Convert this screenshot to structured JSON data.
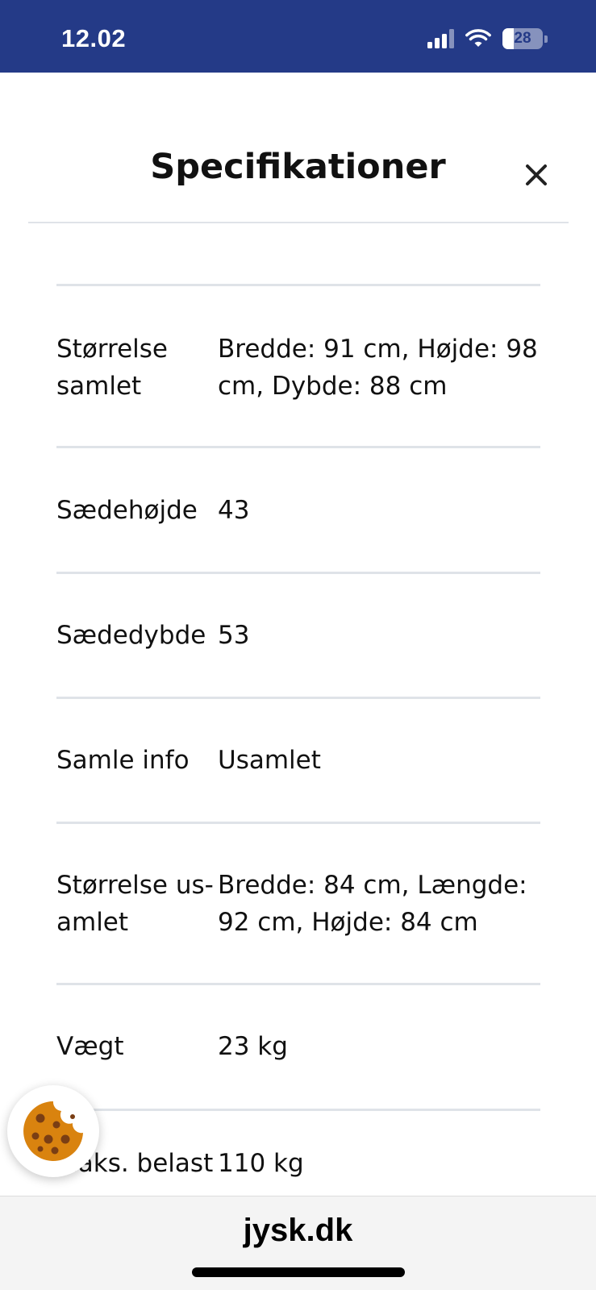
{
  "status_bar": {
    "time": "12.02",
    "battery": "28",
    "battery_level": 0.28,
    "signal_bars": 3,
    "wifi": true
  },
  "modal": {
    "title": "Specifikationer",
    "close_icon": "close-icon"
  },
  "specs": [
    {
      "label_lines": [
        "Størrelse",
        "samlet"
      ],
      "value_lines": [
        "Bredde: 91 cm, Højde: 98",
        "cm, Dybde: 88 cm"
      ]
    },
    {
      "label_lines": [
        "Sædehøjde"
      ],
      "value_lines": [
        "43"
      ]
    },
    {
      "label_lines": [
        "Sædedybde"
      ],
      "value_lines": [
        "53"
      ]
    },
    {
      "label_lines": [
        "Samle info"
      ],
      "value_lines": [
        "Usamlet"
      ]
    },
    {
      "label_lines": [
        "Størrelse us-",
        "amlet"
      ],
      "value_lines": [
        "Bredde: 84 cm, Længde:",
        "92 cm, Højde: 84 cm"
      ]
    },
    {
      "label_lines": [
        "Vægt"
      ],
      "value_lines": [
        "23 kg"
      ]
    },
    {
      "label_lines": [
        "Maks. belast"
      ],
      "value_lines": [
        "110 kg"
      ]
    }
  ],
  "browser": {
    "url": "jysk.dk"
  },
  "cookie_button": {
    "icon": "cookie-icon"
  },
  "colors": {
    "status_bar_bg": "#243a87",
    "divider": "#dfe3e8",
    "cookie": "#d9830f",
    "cookie_chip": "#7a3e14"
  }
}
